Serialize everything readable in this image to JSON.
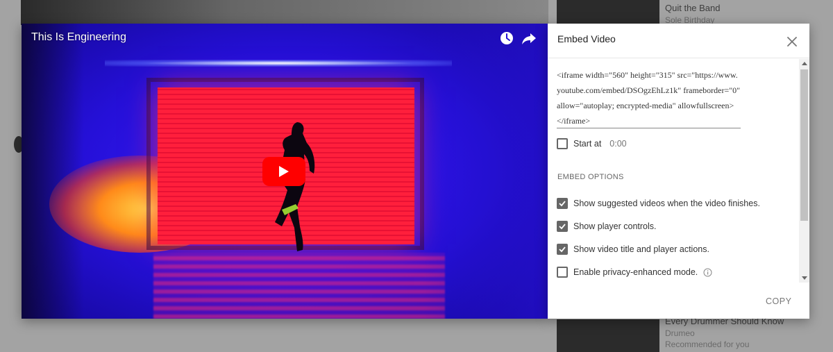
{
  "background": {
    "sidebar_items": [
      {
        "title": "Quit the Band",
        "channel": "Sole Birthday"
      },
      {
        "title": "Every Drummer Should Know",
        "channel": "Drumeo",
        "meta": "Recommended for you"
      }
    ]
  },
  "player": {
    "title": "This Is Engineering",
    "watch_later_icon": "clock-icon",
    "share_icon": "share-arrow-icon",
    "play_icon": "play-icon",
    "play_button_color": "#ff0000"
  },
  "embed": {
    "title": "Embed Video",
    "close_icon": "close-icon",
    "code": "<iframe width=\"560\" height=\"315\" src=\"https://www.youtube.com/embed/DSOgzEhLz1k\" frameborder=\"0\" allow=\"autoplay; encrypted-media\" allowfullscreen></iframe>",
    "start_at": {
      "label": "Start at",
      "placeholder": "0:00",
      "checked": false
    },
    "options_heading": "EMBED OPTIONS",
    "options": [
      {
        "label": "Show suggested videos when the video finishes.",
        "checked": true
      },
      {
        "label": "Show player controls.",
        "checked": true
      },
      {
        "label": "Show video title and player actions.",
        "checked": true
      },
      {
        "label": "Enable privacy-enhanced mode.",
        "checked": false,
        "info_icon": "info-icon"
      }
    ],
    "copy_label": "COPY"
  }
}
